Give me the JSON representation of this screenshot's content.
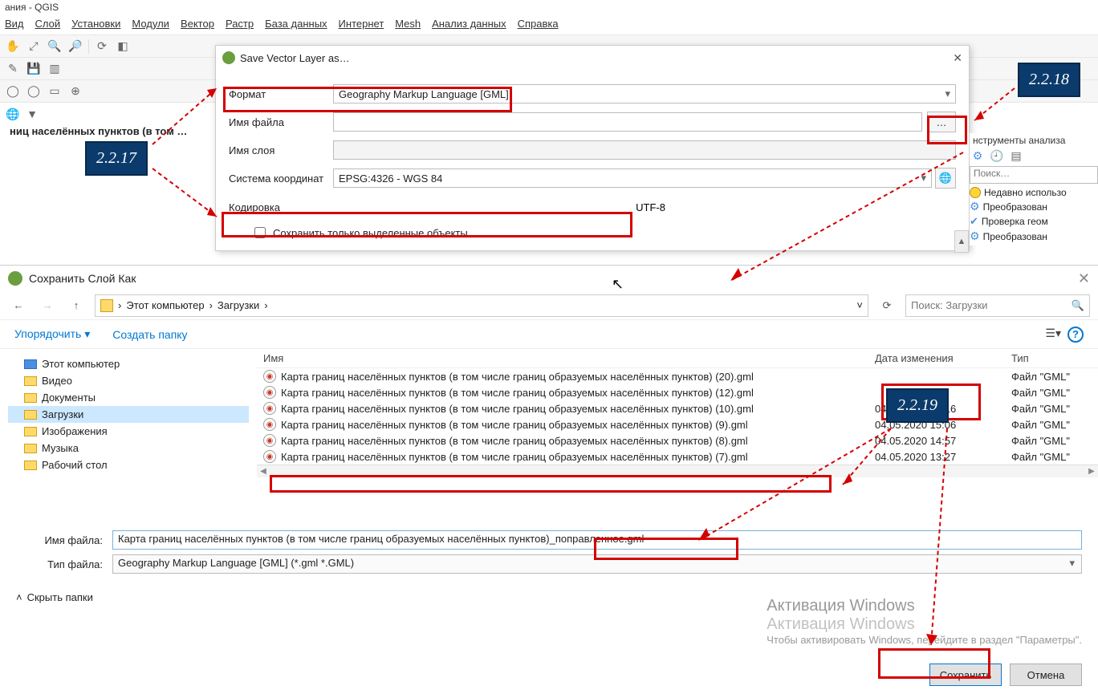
{
  "window_title_suffix": "ания - QGIS",
  "menu": [
    "Вид",
    "Слой",
    "Установки",
    "Модули",
    "Вектор",
    "Растр",
    "База данных",
    "Интернет",
    "Mesh",
    "Анализ данных",
    "Справка"
  ],
  "layer_trunc": "ниц населённых пунктов (в том …",
  "dialog1": {
    "title": "Save Vector Layer as…",
    "format_label": "Формат",
    "format_value": "Geography Markup Language [GML]",
    "filename_label": "Имя файла",
    "layername_label": "Имя слоя",
    "crs_label": "Система координат",
    "crs_value": "EPSG:4326 - WGS 84",
    "encoding_label": "Кодировка",
    "encoding_value": "UTF-8",
    "selected_only": "Сохранить только выделенные объекты"
  },
  "right_panel": {
    "header": "нструменты анализа",
    "search_placeholder": "Поиск…",
    "items": [
      "Недавно использо",
      "Преобразован",
      "Проверка геом",
      "Преобразован"
    ]
  },
  "filedlg": {
    "title": "Сохранить Слой Как",
    "breadcrumb": [
      "Этот компьютер",
      "Загрузки"
    ],
    "search_placeholder": "Поиск: Загрузки",
    "organize": "Упорядочить",
    "new_folder": "Создать папку",
    "columns": {
      "name": "Имя",
      "date": "Дата изменения",
      "type": "Тип"
    },
    "sidebar": [
      "Этот компьютер",
      "Видео",
      "Документы",
      "Загрузки",
      "Изображения",
      "Музыка",
      "Рабочий стол"
    ],
    "sidebar_selected_index": 3,
    "rows": [
      {
        "name": "Карта границ населённых пунктов (в том числе границ образуемых населённых пунктов) (20).gml",
        "date": "",
        "type": "Файл \"GML\""
      },
      {
        "name": "Карта границ населённых пунктов (в том числе границ образуемых населённых пунктов) (12).gml",
        "date": "",
        "type": "Файл \"GML\""
      },
      {
        "name": "Карта границ населённых пунктов (в том числе границ образуемых населённых пунктов) (10).gml",
        "date": "04.05.2020 16:16",
        "type": "Файл \"GML\""
      },
      {
        "name": "Карта границ населённых пунктов (в том числе границ образуемых населённых пунктов) (9).gml",
        "date": "04.05.2020 15:06",
        "type": "Файл \"GML\""
      },
      {
        "name": "Карта границ населённых пунктов (в том числе границ образуемых населённых пунктов) (8).gml",
        "date": "04.05.2020 14:57",
        "type": "Файл \"GML\""
      },
      {
        "name": "Карта границ населённых пунктов (в том числе границ образуемых населённых пунктов) (7).gml",
        "date": "04.05.2020 13:27",
        "type": "Файл \"GML\""
      }
    ],
    "filename_label": "Имя файла:",
    "filename_value": "Карта границ населённых пунктов (в том числе границ образуемых населённых пунктов)_поправленное.gml",
    "filetype_label": "Тип файла:",
    "filetype_value": "Geography Markup Language [GML] (*.gml *.GML)",
    "hide_folders": "Скрыть папки",
    "save_btn": "Сохранить",
    "cancel_btn": "Отмена"
  },
  "callouts": {
    "c1": "2.2.17",
    "c2": "2.2.18",
    "c3": "2.2.19"
  },
  "watermark": {
    "line1": "Активация Windows",
    "line2": "Активация Windows",
    "line3": "Чтобы активировать Windows, перейдите в раздел \"Параметры\"."
  }
}
